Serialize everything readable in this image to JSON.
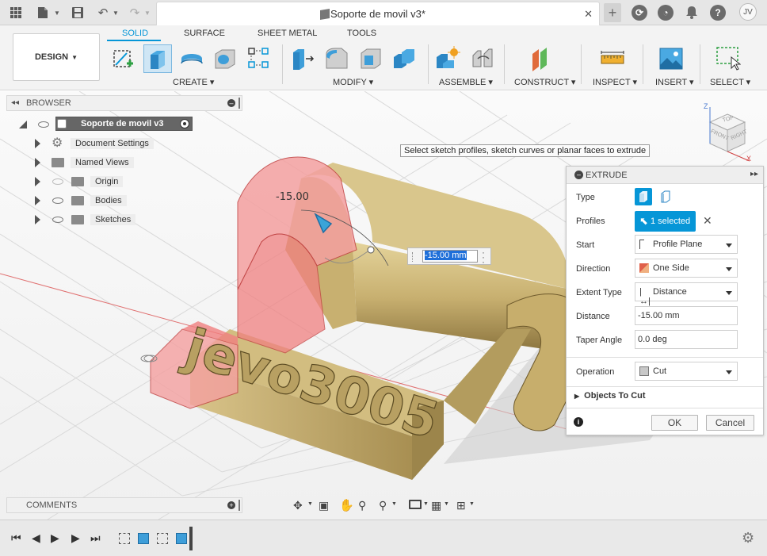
{
  "titlebar": {
    "document_title": "Soporte de movil v3*",
    "user_initials": "JV",
    "icons": [
      "app-grid-icon",
      "file-icon",
      "save-icon",
      "undo-icon",
      "redo-icon",
      "new-tab-icon",
      "online-status-icon",
      "job-status-icon",
      "notifications-icon",
      "help-icon"
    ]
  },
  "toolbar": {
    "workspace_label": "DESIGN",
    "tabs": [
      {
        "label": "SOLID",
        "active": true
      },
      {
        "label": "SURFACE",
        "active": false
      },
      {
        "label": "SHEET METAL",
        "active": false
      },
      {
        "label": "TOOLS",
        "active": false
      }
    ],
    "groups": [
      {
        "label": "CREATE",
        "tools": [
          "create-sketch-icon",
          "extrude-icon",
          "revolve-icon",
          "hole-icon",
          "pattern-icon"
        ]
      },
      {
        "label": "MODIFY",
        "tools": [
          "press-pull-icon",
          "fillet-icon",
          "shell-icon",
          "combine-icon"
        ]
      },
      {
        "label": "ASSEMBLE",
        "tools": [
          "new-component-icon",
          "joint-icon"
        ]
      },
      {
        "label": "CONSTRUCT",
        "tools": [
          "offset-plane-icon"
        ]
      },
      {
        "label": "INSPECT",
        "tools": [
          "measure-icon"
        ]
      },
      {
        "label": "INSERT",
        "tools": [
          "insert-image-icon"
        ]
      },
      {
        "label": "SELECT",
        "tools": [
          "window-select-icon"
        ]
      }
    ]
  },
  "browser": {
    "title": "BROWSER",
    "root": "Soporte de movil v3",
    "items": [
      {
        "label": "Document Settings",
        "icon": "gear-icon"
      },
      {
        "label": "Named Views",
        "icon": "folder-icon"
      },
      {
        "label": "Origin",
        "icon": "folder-icon"
      },
      {
        "label": "Bodies",
        "icon": "folder-icon"
      },
      {
        "label": "Sketches",
        "icon": "folder-icon"
      }
    ]
  },
  "viewport": {
    "tooltip": "Select sketch profiles, sketch curves or planar faces to extrude",
    "dimension_label": "-15.00",
    "distance_input": "-15.00 mm",
    "model_text": "jevo3005",
    "viewcube": {
      "top": "TOP",
      "front": "FRONT",
      "right": "RIGHT",
      "axis_z": "Z",
      "axis_x": "X"
    }
  },
  "extrude": {
    "title": "EXTRUDE",
    "type_label": "Type",
    "profiles_label": "Profiles",
    "profiles_value": "1 selected",
    "start_label": "Start",
    "start_value": "Profile Plane",
    "direction_label": "Direction",
    "direction_value": "One Side",
    "extent_label": "Extent Type",
    "extent_value": "Distance",
    "distance_label": "Distance",
    "distance_value": "-15.00 mm",
    "taper_label": "Taper Angle",
    "taper_value": "0.0 deg",
    "operation_label": "Operation",
    "operation_value": "Cut",
    "objects_to_cut": "Objects To Cut",
    "ok_label": "OK",
    "cancel_label": "Cancel",
    "accent_color": "#0696d7"
  },
  "comments": {
    "title": "COMMENTS"
  },
  "colors": {
    "accent": "#0696d7",
    "cut_preview": "#f08080",
    "body_gold": "#c8b070"
  }
}
